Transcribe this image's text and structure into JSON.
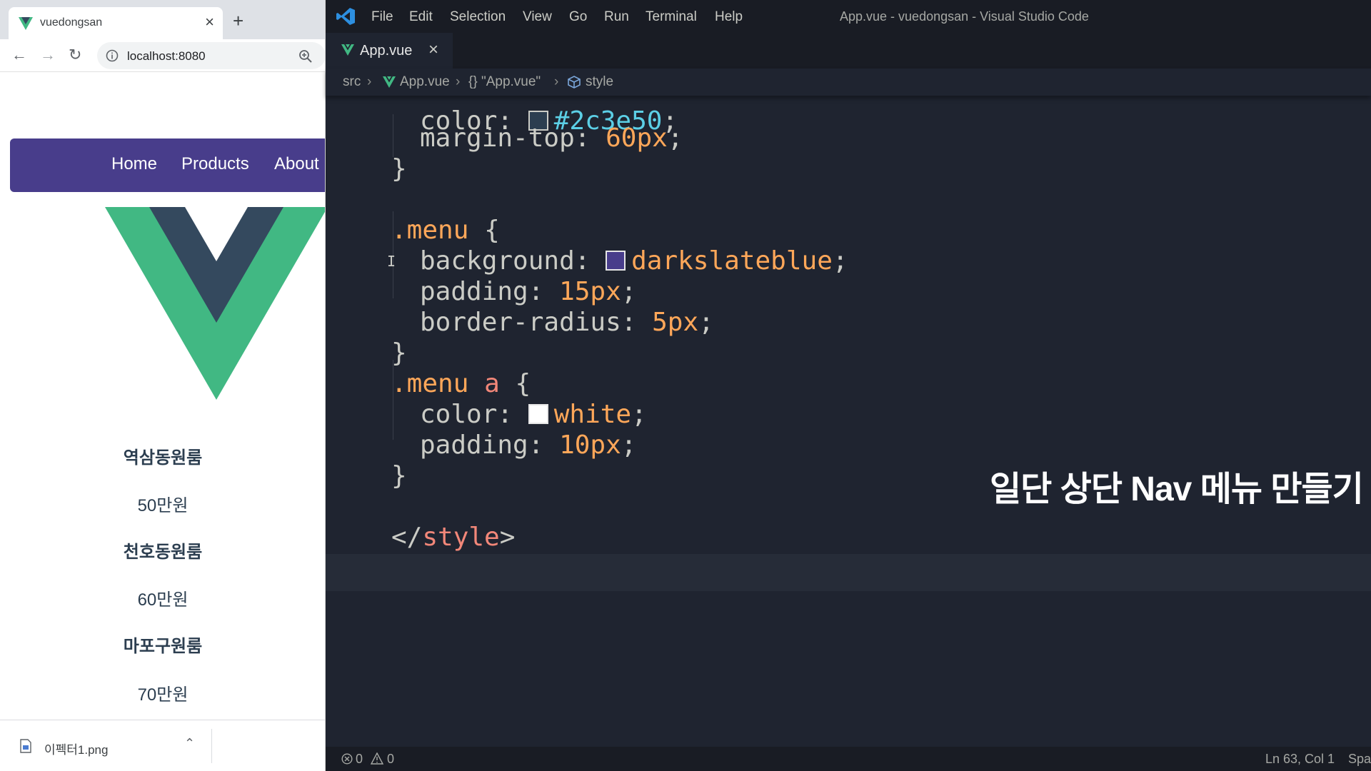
{
  "browser": {
    "tab_title": "vuedongsan",
    "url": "localhost:8080",
    "menu": [
      "Home",
      "Products",
      "About"
    ],
    "rooms": [
      {
        "name": "역삼동원룸",
        "price": "50만원"
      },
      {
        "name": "천호동원룸",
        "price": "60만원"
      },
      {
        "name": "마포구원룸",
        "price": "70만원"
      }
    ],
    "download_file": "이펙터1.png",
    "colors": {
      "menu_bg": "#483d8b",
      "vue_green": "#41b883",
      "vue_dark": "#34495e"
    }
  },
  "vscode": {
    "menu": [
      "File",
      "Edit",
      "Selection",
      "View",
      "Go",
      "Run",
      "Terminal",
      "Help"
    ],
    "window_title": "App.vue - vuedongsan - Visual Studio Code",
    "tab_label": "App.vue",
    "breadcrumbs": [
      "src",
      "App.vue",
      "{} \"App.vue\"",
      "style"
    ],
    "code": {
      "l1": {
        "prop": "margin-top",
        "value": "60px"
      },
      "l2": "}",
      "l3": {
        "selector": ".menu",
        "brace": "{"
      },
      "l4": {
        "prop": "background",
        "value": "darkslateblue",
        "swatch": "#483d8b"
      },
      "l5": {
        "prop": "padding",
        "value": "15px"
      },
      "l6": {
        "prop": "border-radius",
        "value": "5px"
      },
      "l7": "}",
      "l8": {
        "selector": ".menu",
        "tag": "a",
        "brace": "{"
      },
      "l9": {
        "prop": "color",
        "value": "white",
        "swatch": "#ffffff"
      },
      "l10": {
        "prop": "padding",
        "value": "10px"
      },
      "l11": "}",
      "l12": {
        "open": "</",
        "tag": "style",
        "close": ">"
      }
    },
    "caption": "일단 상단 Nav 메뉴 만들기",
    "status": {
      "errors": "0",
      "warnings": "0",
      "position": "Ln 63, Col 1",
      "spaces": "Spa"
    }
  }
}
